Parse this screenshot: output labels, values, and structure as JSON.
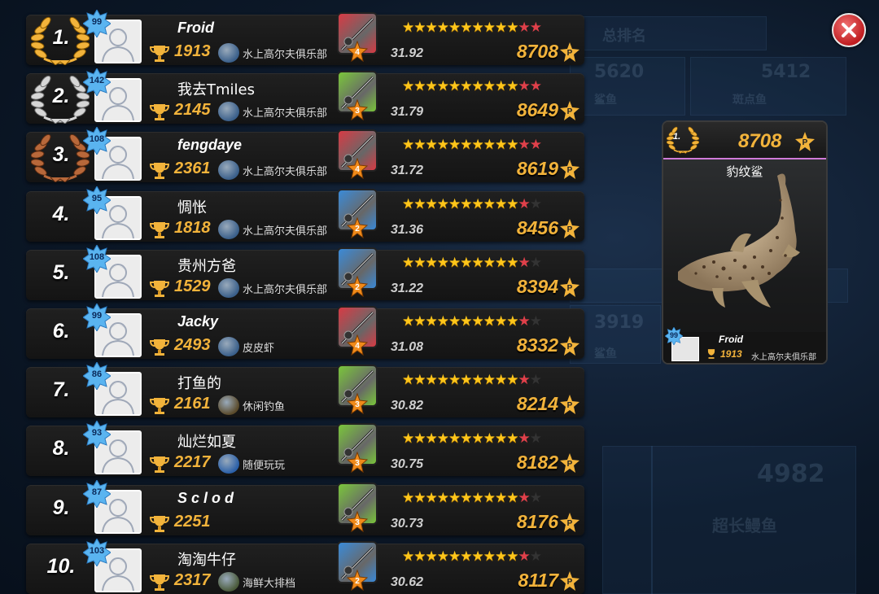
{
  "background_ghost": {
    "title_fragment": "总排名",
    "values": [
      "5620",
      "5412",
      "3919",
      "4982"
    ],
    "labels": [
      "鲨鱼",
      "斑点鱼",
      "鲨鱼",
      "超长鳗鱼"
    ]
  },
  "players": [
    {
      "rank": "1.",
      "level": "99",
      "name": "Froid",
      "name_cjk": false,
      "trophies": "1913",
      "club": "水上高尔夫俱乐部",
      "club_color": "#3a5f8a",
      "rod_color": "#d83a44",
      "rod_level": "4",
      "stars_full": 10,
      "stars_red": 2,
      "stars_empty": 0,
      "weight": "31.92",
      "points": "8708",
      "medal": "gold"
    },
    {
      "rank": "2.",
      "level": "142",
      "name": "我去Tmiles",
      "name_cjk": true,
      "trophies": "2145",
      "club": "水上高尔夫俱乐部",
      "club_color": "#3a5f8a",
      "rod_color": "#7ac63a",
      "rod_level": "3",
      "stars_full": 10,
      "stars_red": 2,
      "stars_empty": 0,
      "weight": "31.79",
      "points": "8649",
      "medal": "silver"
    },
    {
      "rank": "3.",
      "level": "108",
      "name": "fengdaye",
      "name_cjk": false,
      "trophies": "2361",
      "club": "水上高尔夫俱乐部",
      "club_color": "#3a5f8a",
      "rod_color": "#d83a44",
      "rod_level": "4",
      "stars_full": 10,
      "stars_red": 2,
      "stars_empty": 0,
      "weight": "31.72",
      "points": "8619",
      "medal": "bronze"
    },
    {
      "rank": "4.",
      "level": "95",
      "name": "惆怅",
      "name_cjk": true,
      "trophies": "1818",
      "club": "水上高尔夫俱乐部",
      "club_color": "#3a5f8a",
      "rod_color": "#3a8ad8",
      "rod_level": "2",
      "stars_full": 10,
      "stars_red": 1,
      "stars_empty": 1,
      "weight": "31.36",
      "points": "8456",
      "medal": ""
    },
    {
      "rank": "5.",
      "level": "108",
      "name": "贵州方爸",
      "name_cjk": true,
      "trophies": "1529",
      "club": "水上高尔夫俱乐部",
      "club_color": "#3a5f8a",
      "rod_color": "#3a8ad8",
      "rod_level": "2",
      "stars_full": 10,
      "stars_red": 1,
      "stars_empty": 1,
      "weight": "31.22",
      "points": "8394",
      "medal": ""
    },
    {
      "rank": "6.",
      "level": "99",
      "name": "Jacky",
      "name_cjk": false,
      "trophies": "2493",
      "club": "皮皮虾",
      "club_color": "#3a5f8a",
      "rod_color": "#d83a44",
      "rod_level": "4",
      "stars_full": 10,
      "stars_red": 1,
      "stars_empty": 1,
      "weight": "31.08",
      "points": "8332",
      "medal": ""
    },
    {
      "rank": "7.",
      "level": "86",
      "name": "打鱼的",
      "name_cjk": true,
      "trophies": "2161",
      "club": "休闲钓鱼",
      "club_color": "#5a4a2a",
      "rod_color": "#7ac63a",
      "rod_level": "3",
      "stars_full": 10,
      "stars_red": 1,
      "stars_empty": 1,
      "weight": "30.82",
      "points": "8214",
      "medal": ""
    },
    {
      "rank": "8.",
      "level": "93",
      "name": "灿烂如夏",
      "name_cjk": true,
      "trophies": "2217",
      "club": "随便玩玩",
      "club_color": "#2a5fa8",
      "rod_color": "#7ac63a",
      "rod_level": "3",
      "stars_full": 10,
      "stars_red": 1,
      "stars_empty": 1,
      "weight": "30.75",
      "points": "8182",
      "medal": ""
    },
    {
      "rank": "9.",
      "level": "87",
      "name": "S c l o d",
      "name_cjk": false,
      "trophies": "2251",
      "club": "",
      "club_color": "",
      "rod_color": "#7ac63a",
      "rod_level": "3",
      "stars_full": 10,
      "stars_red": 1,
      "stars_empty": 1,
      "weight": "30.73",
      "points": "8176",
      "medal": ""
    },
    {
      "rank": "10.",
      "level": "103",
      "name": "淘淘牛仔",
      "name_cjk": true,
      "trophies": "2317",
      "club": "海鲜大排档",
      "club_color": "#4a5a3a",
      "rod_color": "#3a8ad8",
      "rod_level": "2",
      "stars_full": 10,
      "stars_red": 1,
      "stars_empty": 1,
      "weight": "30.62",
      "points": "8117",
      "medal": ""
    }
  ],
  "card": {
    "rank": "1.",
    "points": "8708",
    "fish": "豹纹鲨",
    "level": "99",
    "name": "Froid",
    "trophies": "1913",
    "club": "水上高尔夫俱乐部"
  },
  "points_symbol": "P",
  "icons": {
    "close": "close-icon",
    "trophy": "trophy-icon",
    "points": "points-coin-icon"
  }
}
